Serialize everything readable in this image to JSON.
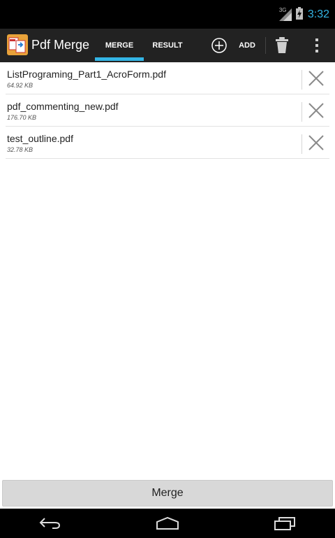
{
  "status_bar": {
    "network": "3G",
    "time": "3:32"
  },
  "action_bar": {
    "app_title": "Pdf Merge",
    "tabs": [
      {
        "label": "MERGE",
        "selected": true
      },
      {
        "label": "RESULT",
        "selected": false
      }
    ],
    "add_label": "ADD",
    "icons": [
      "pdf-merge-app-icon",
      "add-circle-icon",
      "trash-icon",
      "overflow-menu-icon"
    ]
  },
  "files": [
    {
      "name": "ListPrograming_Part1_AcroForm.pdf",
      "size": "64.92 KB"
    },
    {
      "name": "pdf_commenting_new.pdf",
      "size": "176.70 KB"
    },
    {
      "name": "test_outline.pdf",
      "size": "32.78 KB"
    }
  ],
  "merge_button": {
    "label": "Merge"
  },
  "colors": {
    "accent": "#33b5e5",
    "action_bar": "#222222",
    "status_bar": "#000000",
    "button_bg": "#d8d8d8"
  }
}
